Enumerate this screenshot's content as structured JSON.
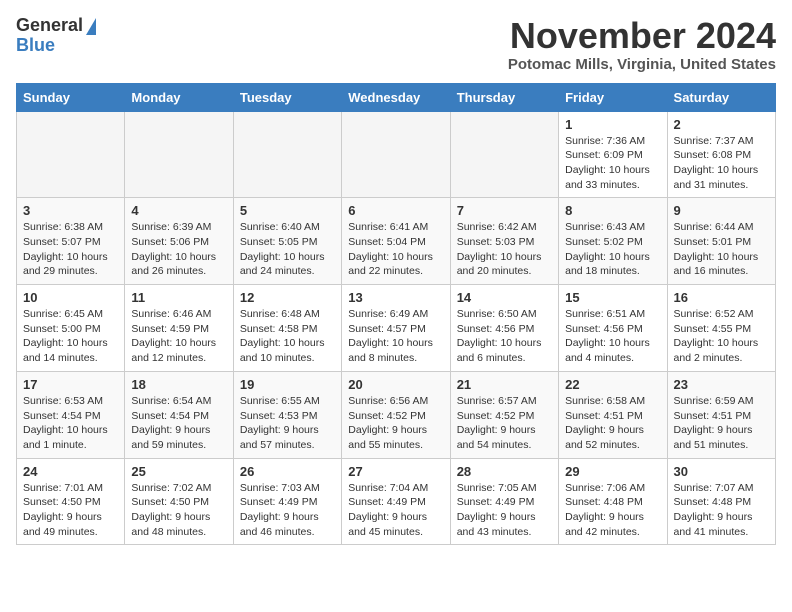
{
  "header": {
    "logo_line1": "General",
    "logo_line2": "Blue",
    "month": "November 2024",
    "location": "Potomac Mills, Virginia, United States"
  },
  "days_of_week": [
    "Sunday",
    "Monday",
    "Tuesday",
    "Wednesday",
    "Thursday",
    "Friday",
    "Saturday"
  ],
  "weeks": [
    [
      {
        "num": "",
        "info": ""
      },
      {
        "num": "",
        "info": ""
      },
      {
        "num": "",
        "info": ""
      },
      {
        "num": "",
        "info": ""
      },
      {
        "num": "",
        "info": ""
      },
      {
        "num": "1",
        "info": "Sunrise: 7:36 AM\nSunset: 6:09 PM\nDaylight: 10 hours and 33 minutes."
      },
      {
        "num": "2",
        "info": "Sunrise: 7:37 AM\nSunset: 6:08 PM\nDaylight: 10 hours and 31 minutes."
      }
    ],
    [
      {
        "num": "3",
        "info": "Sunrise: 6:38 AM\nSunset: 5:07 PM\nDaylight: 10 hours and 29 minutes."
      },
      {
        "num": "4",
        "info": "Sunrise: 6:39 AM\nSunset: 5:06 PM\nDaylight: 10 hours and 26 minutes."
      },
      {
        "num": "5",
        "info": "Sunrise: 6:40 AM\nSunset: 5:05 PM\nDaylight: 10 hours and 24 minutes."
      },
      {
        "num": "6",
        "info": "Sunrise: 6:41 AM\nSunset: 5:04 PM\nDaylight: 10 hours and 22 minutes."
      },
      {
        "num": "7",
        "info": "Sunrise: 6:42 AM\nSunset: 5:03 PM\nDaylight: 10 hours and 20 minutes."
      },
      {
        "num": "8",
        "info": "Sunrise: 6:43 AM\nSunset: 5:02 PM\nDaylight: 10 hours and 18 minutes."
      },
      {
        "num": "9",
        "info": "Sunrise: 6:44 AM\nSunset: 5:01 PM\nDaylight: 10 hours and 16 minutes."
      }
    ],
    [
      {
        "num": "10",
        "info": "Sunrise: 6:45 AM\nSunset: 5:00 PM\nDaylight: 10 hours and 14 minutes."
      },
      {
        "num": "11",
        "info": "Sunrise: 6:46 AM\nSunset: 4:59 PM\nDaylight: 10 hours and 12 minutes."
      },
      {
        "num": "12",
        "info": "Sunrise: 6:48 AM\nSunset: 4:58 PM\nDaylight: 10 hours and 10 minutes."
      },
      {
        "num": "13",
        "info": "Sunrise: 6:49 AM\nSunset: 4:57 PM\nDaylight: 10 hours and 8 minutes."
      },
      {
        "num": "14",
        "info": "Sunrise: 6:50 AM\nSunset: 4:56 PM\nDaylight: 10 hours and 6 minutes."
      },
      {
        "num": "15",
        "info": "Sunrise: 6:51 AM\nSunset: 4:56 PM\nDaylight: 10 hours and 4 minutes."
      },
      {
        "num": "16",
        "info": "Sunrise: 6:52 AM\nSunset: 4:55 PM\nDaylight: 10 hours and 2 minutes."
      }
    ],
    [
      {
        "num": "17",
        "info": "Sunrise: 6:53 AM\nSunset: 4:54 PM\nDaylight: 10 hours and 1 minute."
      },
      {
        "num": "18",
        "info": "Sunrise: 6:54 AM\nSunset: 4:54 PM\nDaylight: 9 hours and 59 minutes."
      },
      {
        "num": "19",
        "info": "Sunrise: 6:55 AM\nSunset: 4:53 PM\nDaylight: 9 hours and 57 minutes."
      },
      {
        "num": "20",
        "info": "Sunrise: 6:56 AM\nSunset: 4:52 PM\nDaylight: 9 hours and 55 minutes."
      },
      {
        "num": "21",
        "info": "Sunrise: 6:57 AM\nSunset: 4:52 PM\nDaylight: 9 hours and 54 minutes."
      },
      {
        "num": "22",
        "info": "Sunrise: 6:58 AM\nSunset: 4:51 PM\nDaylight: 9 hours and 52 minutes."
      },
      {
        "num": "23",
        "info": "Sunrise: 6:59 AM\nSunset: 4:51 PM\nDaylight: 9 hours and 51 minutes."
      }
    ],
    [
      {
        "num": "24",
        "info": "Sunrise: 7:01 AM\nSunset: 4:50 PM\nDaylight: 9 hours and 49 minutes."
      },
      {
        "num": "25",
        "info": "Sunrise: 7:02 AM\nSunset: 4:50 PM\nDaylight: 9 hours and 48 minutes."
      },
      {
        "num": "26",
        "info": "Sunrise: 7:03 AM\nSunset: 4:49 PM\nDaylight: 9 hours and 46 minutes."
      },
      {
        "num": "27",
        "info": "Sunrise: 7:04 AM\nSunset: 4:49 PM\nDaylight: 9 hours and 45 minutes."
      },
      {
        "num": "28",
        "info": "Sunrise: 7:05 AM\nSunset: 4:49 PM\nDaylight: 9 hours and 43 minutes."
      },
      {
        "num": "29",
        "info": "Sunrise: 7:06 AM\nSunset: 4:48 PM\nDaylight: 9 hours and 42 minutes."
      },
      {
        "num": "30",
        "info": "Sunrise: 7:07 AM\nSunset: 4:48 PM\nDaylight: 9 hours and 41 minutes."
      }
    ]
  ]
}
